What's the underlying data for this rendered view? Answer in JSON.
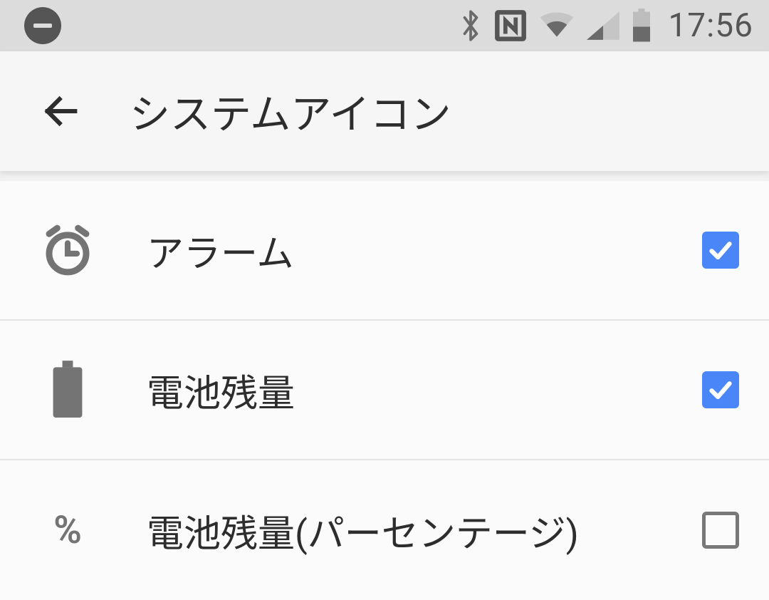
{
  "status_bar": {
    "time": "17:56"
  },
  "app_bar": {
    "title": "システムアイコン"
  },
  "rows": [
    {
      "label": "アラーム",
      "checked": true,
      "icon": "alarm"
    },
    {
      "label": "電池残量",
      "checked": true,
      "icon": "battery"
    },
    {
      "label": "電池残量(パーセンテージ)",
      "checked": false,
      "icon": "percent"
    }
  ]
}
